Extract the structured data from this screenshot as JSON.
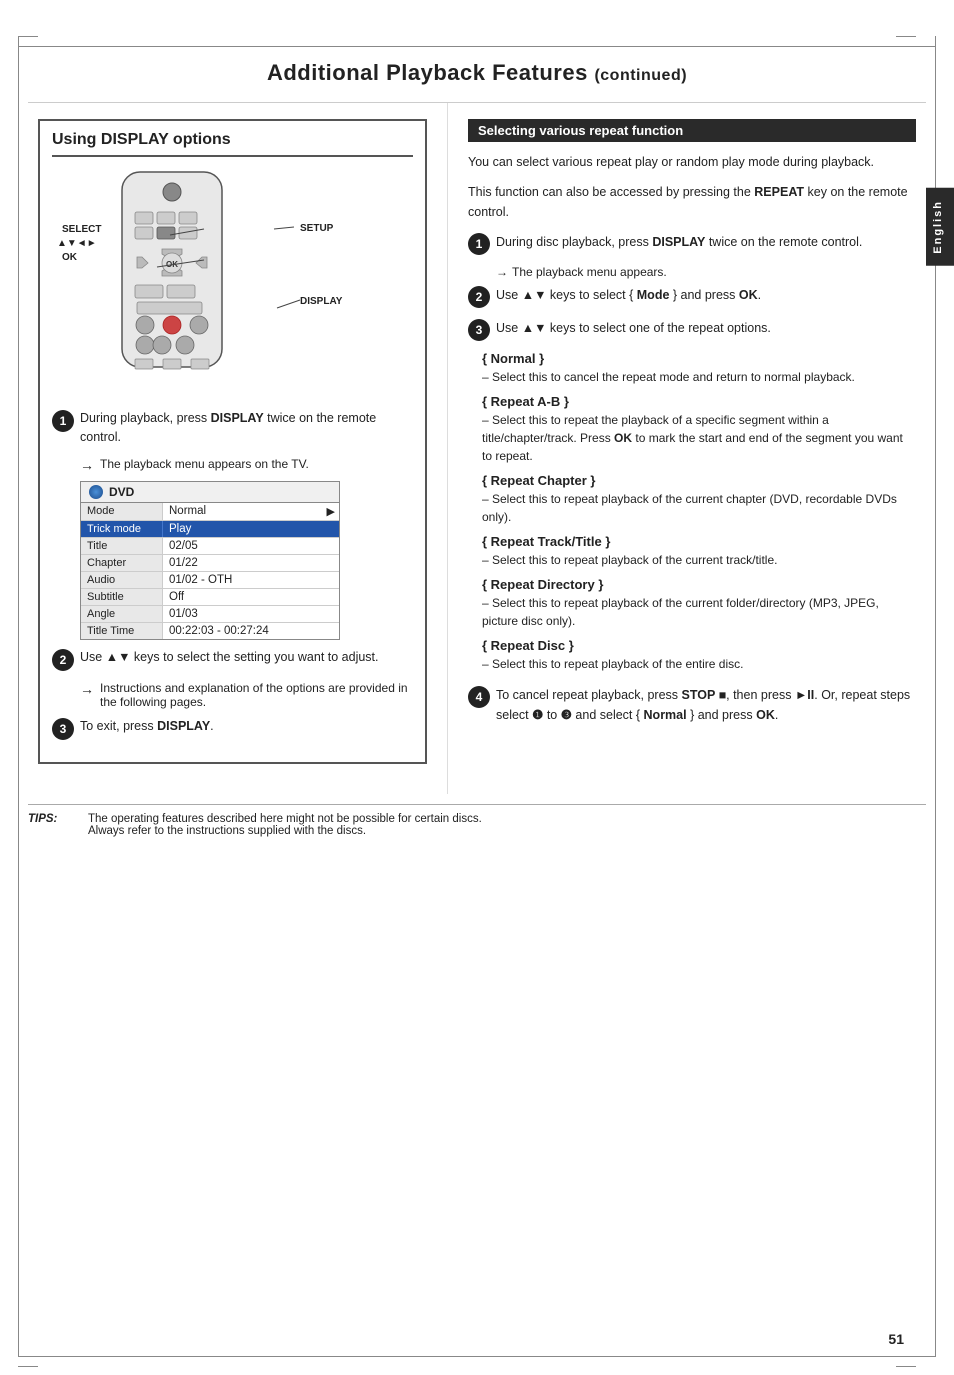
{
  "page": {
    "title": "Additional Playback Features",
    "title_continued": "(continued)",
    "page_number": "51",
    "language_tab": "English"
  },
  "left_section": {
    "title": "Using DISPLAY options",
    "labels": {
      "select": "SELECT",
      "arrows": "▲▼◄►",
      "ok": "OK",
      "setup": "SETUP",
      "display": "DISPLAY"
    },
    "dvd_menu": {
      "header": "DVD",
      "rows": [
        {
          "label": "Mode",
          "value": "Normal",
          "arrow": "▶",
          "highlight": false
        },
        {
          "label": "Trick mode",
          "value": "Play",
          "arrow": "",
          "highlight": true
        },
        {
          "label": "Title",
          "value": "02/05",
          "arrow": "",
          "highlight": false
        },
        {
          "label": "Chapter",
          "value": "01/22",
          "arrow": "",
          "highlight": false
        },
        {
          "label": "Audio",
          "value": "01/02 - OTH",
          "arrow": "",
          "highlight": false
        },
        {
          "label": "Subtitle",
          "value": "Off",
          "arrow": "",
          "highlight": false
        },
        {
          "label": "Angle",
          "value": "01/03",
          "arrow": "",
          "highlight": false
        },
        {
          "label": "Title Time",
          "value": "00:22:03 - 00:27:24",
          "arrow": "",
          "highlight": false
        }
      ]
    },
    "steps": [
      {
        "num": "1",
        "text": "During playback, press ",
        "bold": "DISPLAY",
        "text2": " twice on the remote control.",
        "note": "The playback menu appears on the TV."
      },
      {
        "num": "2",
        "text": "Use ",
        "bold": "▲▼",
        "text2": " keys to select the setting you want to adjust.",
        "note": "Instructions and explanation of the options are provided in the following pages."
      },
      {
        "num": "3",
        "text": "To exit, press ",
        "bold": "DISPLAY",
        "text2": "."
      }
    ]
  },
  "right_section": {
    "header": "Selecting various repeat function",
    "intro1": "You can select various repeat play or random play mode during playback.",
    "intro2": "This function can also be accessed by pressing the REPEAT key on the remote control.",
    "steps": [
      {
        "num": "1",
        "text": "During disc playback, press ",
        "bold": "DISPLAY",
        "text2": " twice on the remote control.",
        "note": "The playback menu appears."
      },
      {
        "num": "2",
        "text": "Use ▲▼ keys to select { ",
        "bold": "Mode",
        "text2": " } and press ",
        "bold2": "OK",
        "text3": "."
      },
      {
        "num": "3",
        "text": "Use ▲▼ keys to select one of the repeat options."
      },
      {
        "num": "4",
        "text": "To cancel repeat playback, press STOP ■, then press ►II. Or, repeat steps select ❶ to ❸ and select { Normal } and press OK."
      }
    ],
    "options": [
      {
        "title": "{ Normal }",
        "desc": "– Select this to cancel the repeat mode and return to normal playback."
      },
      {
        "title": "{ Repeat A-B }",
        "desc": "– Select this to repeat the playback of a specific segment within a title/chapter/track. Press OK to mark the start and end of the segment you want to repeat."
      },
      {
        "title": "{ Repeat Chapter }",
        "desc": "– Select this to repeat playback of the current chapter (DVD, recordable DVDs only)."
      },
      {
        "title": "{ Repeat Track/Title }",
        "desc": "– Select this to repeat playback of the current track/title."
      },
      {
        "title": "{ Repeat Directory }",
        "desc": "– Select this to repeat playback of the current folder/directory (MP3, JPEG, picture disc only)."
      },
      {
        "title": "{ Repeat Disc }",
        "desc": "– Select this to repeat playback of the entire disc."
      }
    ]
  },
  "tips": {
    "label": "TIPS:",
    "text1": "The operating features described here might not be possible for certain discs.",
    "text2": "Always refer to the instructions supplied with the discs."
  }
}
